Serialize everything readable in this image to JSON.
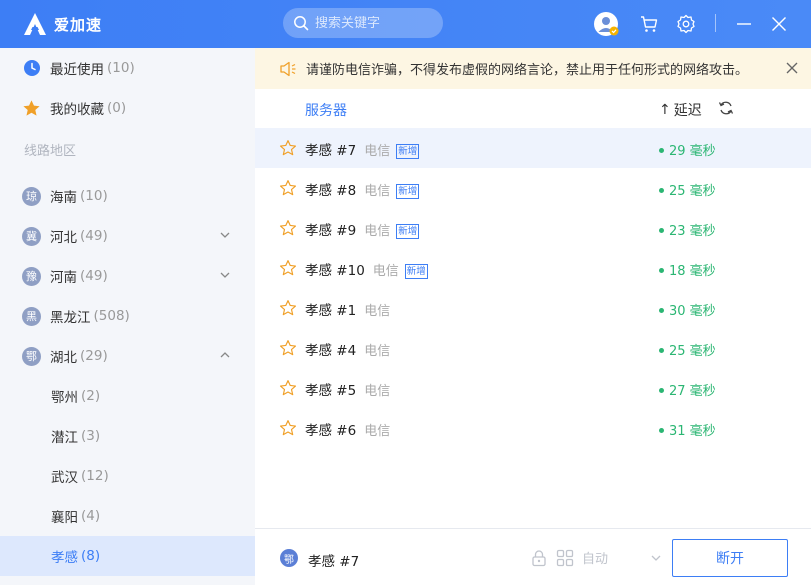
{
  "app": {
    "name": "爱加速"
  },
  "search": {
    "placeholder": "搜索关键字"
  },
  "sidebar": {
    "recent": {
      "label": "最近使用",
      "count": "(10)"
    },
    "favorites": {
      "label": "我的收藏",
      "count": "(0)"
    },
    "section_title": "线路地区",
    "regions": [
      {
        "badge": "琼",
        "label": "海南",
        "count": "(10)"
      },
      {
        "badge": "冀",
        "label": "河北",
        "count": "(49)"
      },
      {
        "badge": "豫",
        "label": "河南",
        "count": "(49)"
      },
      {
        "badge": "黑",
        "label": "黑龙江",
        "count": "(508)"
      },
      {
        "badge": "鄂",
        "label": "湖北",
        "count": "(29)"
      }
    ],
    "subregions": [
      {
        "label": "鄂州",
        "count": "(2)"
      },
      {
        "label": "潜江",
        "count": "(3)"
      },
      {
        "label": "武汉",
        "count": "(12)"
      },
      {
        "label": "襄阳",
        "count": "(4)"
      },
      {
        "label": "孝感",
        "count": "(8)"
      }
    ]
  },
  "notice": {
    "text": "请谨防电信诈骗，不得发布虚假的网络言论，禁止用于任何形式的网络攻击。"
  },
  "list_header": {
    "server": "服务器",
    "latency": "延迟",
    "sort_arrow": "↑"
  },
  "servers": [
    {
      "name": "孝感 #7",
      "isp": "电信",
      "tag": "新增",
      "latency": "29 毫秒"
    },
    {
      "name": "孝感 #8",
      "isp": "电信",
      "tag": "新增",
      "latency": "25 毫秒"
    },
    {
      "name": "孝感 #9",
      "isp": "电信",
      "tag": "新增",
      "latency": "23 毫秒"
    },
    {
      "name": "孝感 #10",
      "isp": "电信",
      "tag": "新增",
      "latency": "18 毫秒"
    },
    {
      "name": "孝感 #1",
      "isp": "电信",
      "tag": "",
      "latency": "30 毫秒"
    },
    {
      "name": "孝感 #4",
      "isp": "电信",
      "tag": "",
      "latency": "25 毫秒"
    },
    {
      "name": "孝感 #5",
      "isp": "电信",
      "tag": "",
      "latency": "27 毫秒"
    },
    {
      "name": "孝感 #6",
      "isp": "电信",
      "tag": "",
      "latency": "31 毫秒"
    }
  ],
  "bottom": {
    "current_badge": "鄂",
    "current_name": "孝感 #7",
    "mode": "自动",
    "disconnect_label": "断开"
  },
  "colors": {
    "primary": "#3d7ef5",
    "latency_green": "#2bb673",
    "notice_bg": "#fdf6e3",
    "star": "#f0a028"
  }
}
